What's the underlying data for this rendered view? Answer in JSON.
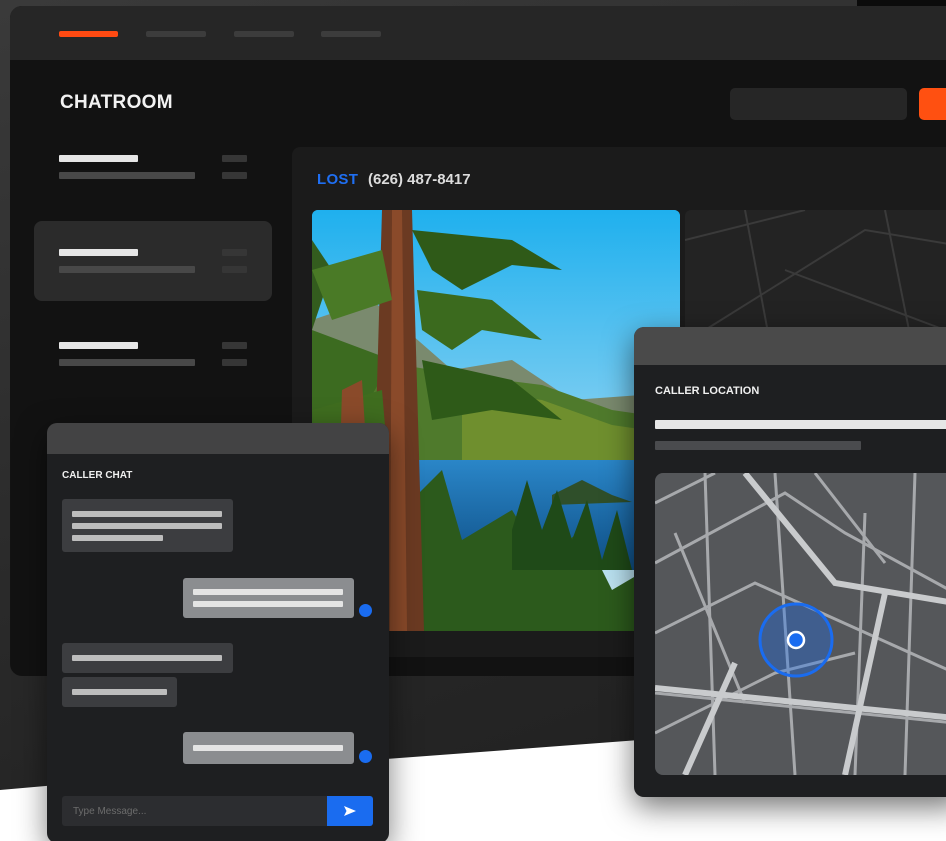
{
  "nav": {
    "tabs": [
      {
        "name": "tab-1",
        "active": true
      },
      {
        "name": "tab-2",
        "active": false
      },
      {
        "name": "tab-3",
        "active": false
      },
      {
        "name": "tab-4",
        "active": false
      }
    ]
  },
  "header": {
    "title": "CHATROOM"
  },
  "conversation_list": {
    "item_count": 3,
    "selected_index": 1
  },
  "detail": {
    "status": "LOST",
    "phone": "(626) 487-8417"
  },
  "chat": {
    "title": "CALLER CHAT",
    "input_placeholder": "Type Message...",
    "send_icon": "send-arrow-icon"
  },
  "location": {
    "title": "CALLER LOCATION",
    "marker_icon": "location-marker-icon"
  },
  "colors": {
    "accent_orange": "#ff4a12",
    "accent_blue": "#1a6cf0",
    "panel": "#1e1f21",
    "background": "#121212"
  }
}
